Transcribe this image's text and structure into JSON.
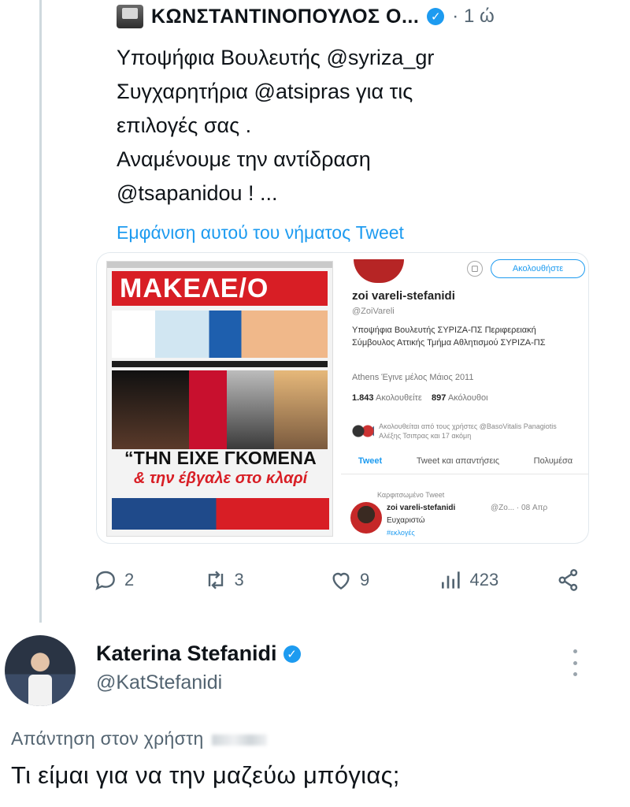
{
  "quoted_tweet": {
    "author_name": "ΚΩΝΣΤΑΝΤΙΝΟΠΟΥΛΟΣ Ο...",
    "verified_mark": "✓",
    "time": "· 1 ώ",
    "text_lines": [
      "Υποψήφια Βουλευτής @syriza_gr",
      "Συγχαρητήρια  @atsipras  για τις",
      "επιλογές σας .",
      "Αναμένουμε την αντίδραση",
      "@tsapanidou ! ..."
    ],
    "show_more": "Εμφάνιση αυτού του νήματος Tweet"
  },
  "media": {
    "newspaper": {
      "masthead": "ΜΑΚΕΛΕ/Ο",
      "headline": "“ΤΗΝ ΕΙΧΕ ΓΚΟΜΕΝΑ",
      "subheadline": "& την έβγαλε στο κλαρί"
    },
    "profile": {
      "follow_button": "Ακολουθήστε",
      "name": "zoi vareli-stefanidi",
      "handle": "@ZoiVareli",
      "bio": "Υποψήφια Βουλευτής ΣΥΡΙΖΑ-ΠΣ Περιφερειακή Σύμβουλος Αττικής Τμήμα Αθλητισμού ΣΥΡΙΖΑ-ΠΣ",
      "location_line": "Athens   Έγινε μέλος Μάιος 2011",
      "following_count": "1.843",
      "following_label": "Ακολουθείτε",
      "followers_count": "897",
      "followers_label": "Ακόλουθοι",
      "mutual_text": "Ακολουθείται από τους χρήστες @BasoVitalis Panagiotis Αλέξης Τσιπρας και 17 ακόμη",
      "tabs": [
        "Tweet",
        "Tweet και απαντήσεις",
        "Πολυμέσα"
      ],
      "pinned_label": "Καρφιτσωμένο Tweet",
      "pinned_author": "zoi vareli-stefanidi",
      "pinned_meta": "@Zo... · 08 Απρ",
      "pinned_text": "Ευχαριστώ",
      "pinned_tag": "#εκλογές"
    }
  },
  "actions": {
    "replies": "2",
    "retweets": "3",
    "likes": "9",
    "views": "423"
  },
  "reply": {
    "author_name": "Katerina Stefanidi",
    "handle": "@KatStefanidi",
    "replying_to": "Απάντηση στον χρήστη",
    "text": "Τι είμαι για να την μαζεύω μπόγιας;"
  },
  "colors": {
    "accent": "#1d9bf0",
    "secondary_text": "#536471",
    "brand_red": "#d81e25"
  },
  "icons": [
    "reply-icon",
    "retweet-icon",
    "like-icon",
    "views-icon",
    "share-icon",
    "more-icon",
    "verified-icon"
  ]
}
